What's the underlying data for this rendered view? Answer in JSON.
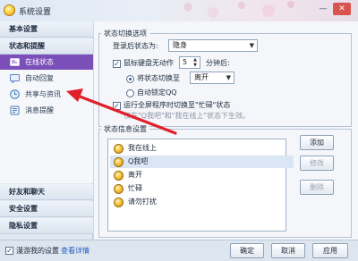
{
  "window": {
    "title": "系统设置",
    "minimize_glyph": "—",
    "close_glyph": "✕"
  },
  "sidebar": {
    "sections": [
      {
        "label": "基本设置"
      },
      {
        "label": "状态和提醒"
      },
      {
        "label": "好友和聊天"
      },
      {
        "label": "安全设置"
      },
      {
        "label": "隐私设置"
      }
    ],
    "items": [
      {
        "label": "在线状态",
        "icon": "status-icon",
        "active": true
      },
      {
        "label": "自动回复",
        "icon": "reply-icon"
      },
      {
        "label": "共享与资讯",
        "icon": "share-icon"
      },
      {
        "label": "消息提醒",
        "icon": "bell-icon"
      }
    ]
  },
  "status_switch": {
    "legend": "状态切换选项",
    "login_status_label": "登录后状态为:",
    "login_status_value": "隐身",
    "idle_label": "鼠标键盘无动作",
    "idle_minutes": "5",
    "minutes_suffix": "分钟后:",
    "switch_to_label": "将状态切换至",
    "switch_to_value": "离开",
    "auto_lock_label": "自动锁定QQ",
    "fullscreen_label": "运行全屏程序时切换至\"忙碌\"状态",
    "fullscreen_hint": "仅在\"Q我吧\"和\"我在线上\"状态下生效。"
  },
  "status_info": {
    "legend": "状态信息设置",
    "rows": [
      {
        "label": "我在线上"
      },
      {
        "label": "Q我吧"
      },
      {
        "label": "离开"
      },
      {
        "label": "忙碌"
      },
      {
        "label": "请勿打扰"
      }
    ],
    "add_button": "添加",
    "edit_button": "修改",
    "delete_button": "删除"
  },
  "footer": {
    "roam_label": "漫游我的设置",
    "details_link": "查看详情",
    "ok_button": "确定",
    "cancel_button": "取消",
    "apply_button": "应用"
  },
  "colors": {
    "active_item": "#7b4fb8",
    "annotation_arrow": "#e0202a",
    "link": "#1f5fbf"
  }
}
